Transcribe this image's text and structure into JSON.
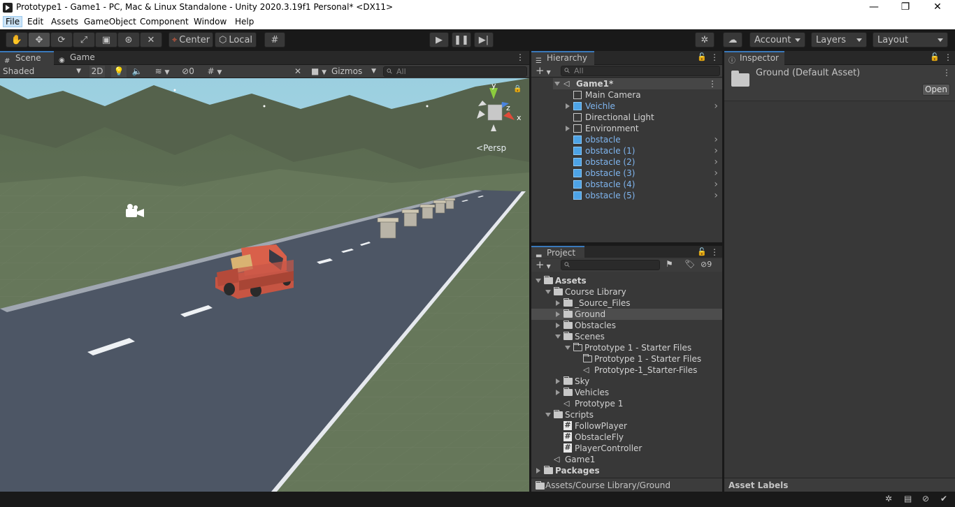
{
  "window": {
    "title": "Prototype1 - Game1 - PC, Mac & Linux Standalone - Unity 2020.3.19f1 Personal* <DX11>",
    "minimize": "—",
    "maximize": "❐",
    "close": "✕"
  },
  "menu": [
    "File",
    "Edit",
    "Assets",
    "GameObject",
    "Component",
    "Window",
    "Help"
  ],
  "toolbar": {
    "pivot": "Center",
    "space": "Local",
    "account": "Account",
    "layers": "Layers",
    "layout": "Layout"
  },
  "scene_tabs": {
    "scene": "Scene",
    "game": "Game"
  },
  "scene_toolbar": {
    "shading": "Shaded",
    "mode_2d": "2D",
    "hidden_count": "0",
    "gizmos": "Gizmos",
    "search_placeholder": "All",
    "persp": "Persp"
  },
  "gizmo_axes": {
    "x": "x",
    "y": "y",
    "z": "z"
  },
  "hierarchy": {
    "title": "Hierarchy",
    "search_placeholder": "All",
    "scene_name": "Game1*",
    "items": [
      {
        "label": "Main Camera",
        "prefab": false,
        "expandable": false
      },
      {
        "label": "Veichle",
        "prefab": true,
        "expandable": true
      },
      {
        "label": "Directional Light",
        "prefab": false,
        "expandable": false
      },
      {
        "label": "Environment",
        "prefab": false,
        "expandable": true
      },
      {
        "label": "obstacle",
        "prefab": true,
        "expandable": false
      },
      {
        "label": "obstacle (1)",
        "prefab": true,
        "expandable": false
      },
      {
        "label": "obstacle (2)",
        "prefab": true,
        "expandable": false
      },
      {
        "label": "obstacle (3)",
        "prefab": true,
        "expandable": false
      },
      {
        "label": "obstacle (4)",
        "prefab": true,
        "expandable": false
      },
      {
        "label": "obstacle (5)",
        "prefab": true,
        "expandable": false
      }
    ]
  },
  "project": {
    "title": "Project",
    "hidden_count": "9",
    "tree": [
      {
        "label": "Assets",
        "depth": 0,
        "kind": "folder",
        "expanded": true,
        "bold": true
      },
      {
        "label": "Course Library",
        "depth": 1,
        "kind": "folder",
        "expanded": true
      },
      {
        "label": "_Source_Files",
        "depth": 2,
        "kind": "folder",
        "expanded": false
      },
      {
        "label": "Ground",
        "depth": 2,
        "kind": "folder",
        "expanded": false,
        "selected": true
      },
      {
        "label": "Obstacles",
        "depth": 2,
        "kind": "folder",
        "expanded": false
      },
      {
        "label": "Scenes",
        "depth": 2,
        "kind": "folder",
        "expanded": true
      },
      {
        "label": "Prototype 1 - Starter Files",
        "depth": 3,
        "kind": "folder-open",
        "expanded": true
      },
      {
        "label": "Prototype 1 - Starter Files",
        "depth": 4,
        "kind": "folder-empty"
      },
      {
        "label": "Prototype-1_Starter-Files",
        "depth": 4,
        "kind": "scene"
      },
      {
        "label": "Sky",
        "depth": 2,
        "kind": "folder",
        "expanded": false
      },
      {
        "label": "Vehicles",
        "depth": 2,
        "kind": "folder",
        "expanded": false
      },
      {
        "label": "Prototype 1",
        "depth": 2,
        "kind": "scene"
      },
      {
        "label": "Scripts",
        "depth": 1,
        "kind": "folder",
        "expanded": true
      },
      {
        "label": "FollowPlayer",
        "depth": 2,
        "kind": "script"
      },
      {
        "label": "ObstacleFly",
        "depth": 2,
        "kind": "script"
      },
      {
        "label": "PlayerController",
        "depth": 2,
        "kind": "script"
      },
      {
        "label": "Game1",
        "depth": 1,
        "kind": "scene"
      },
      {
        "label": "Packages",
        "depth": 0,
        "kind": "folder",
        "expanded": false,
        "bold": true
      }
    ],
    "path": "Assets/Course Library/Ground"
  },
  "inspector": {
    "title": "Inspector",
    "asset_name": "Ground (Default Asset)",
    "open_button": "Open",
    "asset_labels": "Asset Labels"
  },
  "colors": {
    "accent": "#3a79bb",
    "prefab_blue": "#7fb5ef",
    "panel_bg": "#383838",
    "selected_row": "#4d4d4d"
  }
}
